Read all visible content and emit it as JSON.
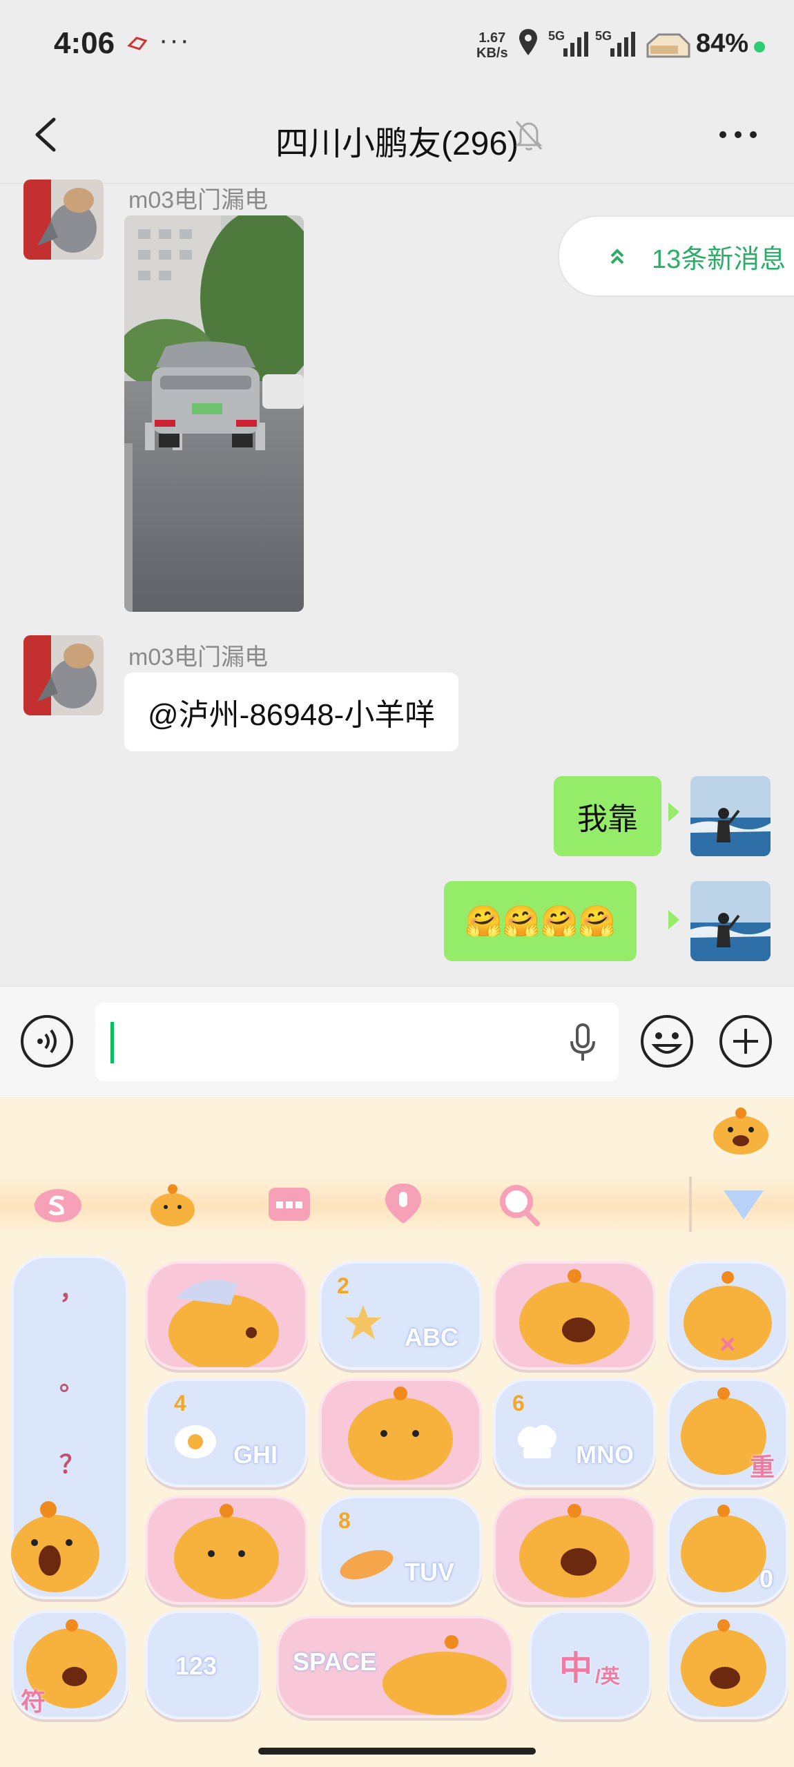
{
  "status_bar": {
    "time": "4:06",
    "dots": "···",
    "net_speed_value": "1.67",
    "net_speed_unit": "KB/s",
    "network_1": "5G",
    "network_2": "5G",
    "battery": "84%"
  },
  "header": {
    "title": "四川小鹏友(296)"
  },
  "new_messages": {
    "label": "13条新消息"
  },
  "messages": [
    {
      "sender": "m03电门漏电",
      "type": "image"
    },
    {
      "sender": "m03电门漏电",
      "type": "text",
      "text": "@泸州-86948-小羊咩"
    },
    {
      "sender": "me",
      "type": "text",
      "text": "我靠"
    },
    {
      "sender": "me",
      "type": "emoji",
      "text": "🤗🤗🤗🤗"
    }
  ],
  "input": {
    "value": ""
  },
  "keyboard": {
    "keys": {
      "punct_comma": "，",
      "punct_period": "。",
      "punct_question": "？",
      "punct_exclaim": "！",
      "abc_num": "2",
      "abc": "ABC",
      "ghi_num": "4",
      "ghi": "GHI",
      "mno_num": "6",
      "mno": "MNO",
      "tuv_num": "8",
      "tuv": "TUV",
      "reset": "重",
      "zero": "0",
      "symbols": "符",
      "num_123": "123",
      "space": "SPACE",
      "zh_en_main": "中",
      "zh_en_sub": "/英"
    }
  },
  "colors": {
    "wechat_green": "#07c160",
    "bubble_green": "#95ec69",
    "keyboard_bg": "#fdf3dc"
  }
}
